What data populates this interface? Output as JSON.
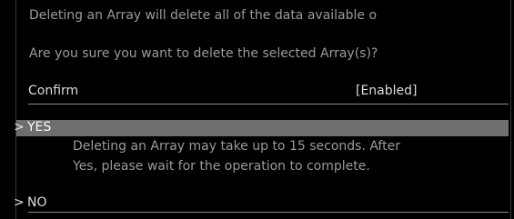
{
  "dialog": {
    "warning_line": "Deleting an Array will delete all of the data available o",
    "question": "Are you sure you want to delete the selected Array(s)?",
    "confirm_label": "Confirm",
    "confirm_value": "[Enabled]",
    "options": [
      {
        "arrow": ">",
        "label": "YES",
        "selected": true
      },
      {
        "arrow": ">",
        "label": "NO",
        "selected": false
      }
    ],
    "help_line_1": "Deleting an Array may take up to 15 seconds. After",
    "help_line_2": "Yes, please wait for the operation to complete."
  },
  "colors": {
    "background": "#000000",
    "text": "#c8c8c8",
    "selection_bar": "#6e6e6e"
  }
}
